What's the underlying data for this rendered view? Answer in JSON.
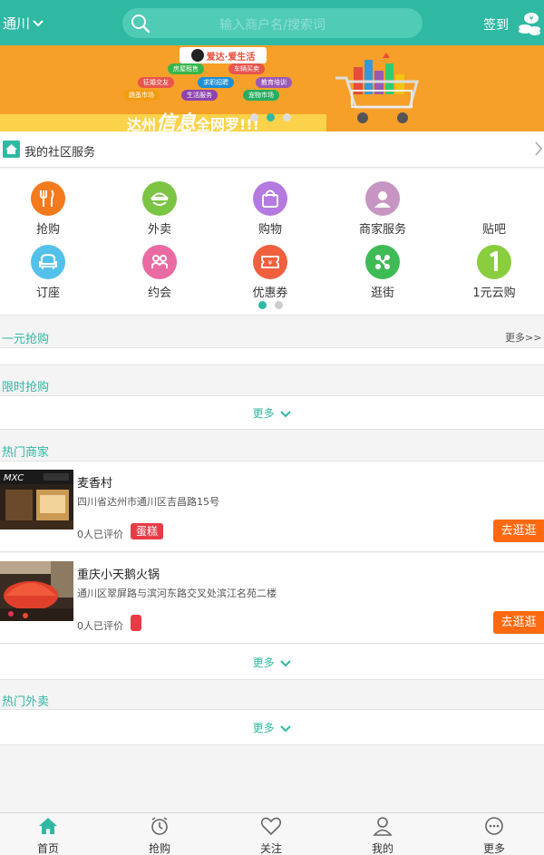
{
  "header": {
    "city": "通川",
    "search_placeholder": "输入商户名/搜索词",
    "signin": "签到"
  },
  "banner": {
    "logo_text": "爱达·爱生活",
    "tags": [
      "房屋租售",
      "车辆买卖",
      "征婚交友",
      "求职招聘",
      "教育培训",
      "跳蚤市场",
      "生活服务",
      "宠物市场"
    ],
    "slogan_prefix": "达州",
    "slogan_big": "信息",
    "slogan_suffix": "全网罗!!!",
    "active_slide": 1,
    "slide_count": 3
  },
  "community": {
    "title": "我的社区服务",
    "items": [
      {
        "label": "抢购",
        "icon": "fork-knife-icon",
        "color": "#f47a1e"
      },
      {
        "label": "外卖",
        "icon": "takeout-bowl-icon",
        "color": "#7cc443"
      },
      {
        "label": "购物",
        "icon": "shopping-bag-icon",
        "color": "#b47ae0"
      },
      {
        "label": "商家服务",
        "icon": "merchant-person-icon",
        "color": "#c695c2"
      },
      {
        "label": "贴吧",
        "icon": "",
        "color": ""
      },
      {
        "label": "订座",
        "icon": "seat-icon",
        "color": "#53c1ea"
      },
      {
        "label": "约会",
        "icon": "dating-icon",
        "color": "#ea6aa3"
      },
      {
        "label": "优惠券",
        "icon": "coupon-icon",
        "color": "#f0603e"
      },
      {
        "label": "逛街",
        "icon": "share-network-icon",
        "color": "#3fbb56"
      },
      {
        "label": "1元云购",
        "icon": "one-yuan-icon",
        "color": "#8acd3e"
      }
    ],
    "active_page": 0
  },
  "sections": {
    "one_yuan": {
      "title": "一元抢购",
      "more": "更多>>"
    },
    "flash": {
      "title": "限时抢购",
      "more": "更多"
    },
    "hot_shops": {
      "title": "热门商家",
      "more": "更多"
    },
    "hot_takeout": {
      "title": "热门外卖",
      "more": "更多"
    }
  },
  "shops": [
    {
      "name": "麦香村",
      "address": "四川省达州市通川区吉昌路15号",
      "reviews": "0人已评价",
      "badge": "蛋糕",
      "go": "去逛逛"
    },
    {
      "name": "重庆小天鹅火锅",
      "address": "通川区翠屏路与滨河东路交叉处滨江名苑二楼",
      "reviews": "0人已评价",
      "badge": "",
      "go": "去逛逛"
    }
  ],
  "nav": {
    "items": [
      {
        "label": "首页",
        "icon": "home-icon",
        "active": true
      },
      {
        "label": "抢购",
        "icon": "alarm-clock-icon",
        "active": false
      },
      {
        "label": "关注",
        "icon": "heart-icon",
        "active": false
      },
      {
        "label": "我的",
        "icon": "user-icon",
        "active": false
      },
      {
        "label": "更多",
        "icon": "more-dots-icon",
        "active": false
      }
    ]
  },
  "colors": {
    "brand": "#2fb9a3",
    "accent_orange": "#ff6a10",
    "badge_red": "#e83b46"
  }
}
